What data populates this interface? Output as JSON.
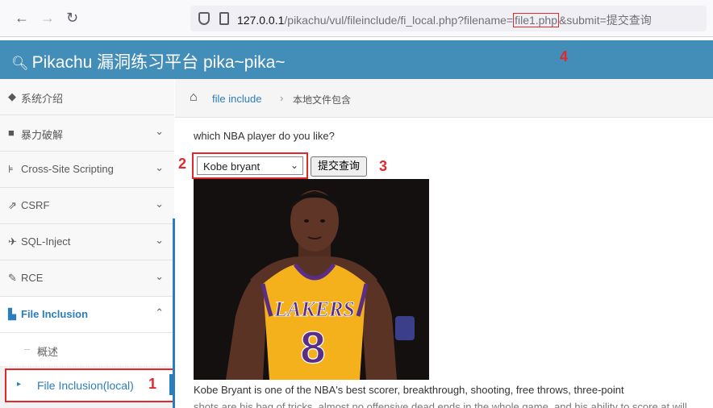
{
  "browser": {
    "url_prefix": "127.0.0.1",
    "url_path": "/pikachu/vul/fileinclude/fi_local.php?filename=",
    "url_filename": "file1.php",
    "url_suffix": "&submit=提交查询"
  },
  "header": {
    "brand": "Pikachu 漏洞练习平台 pika~pika~"
  },
  "sidebar": {
    "items": [
      {
        "label": "系统介绍",
        "icon": "tag-icon"
      },
      {
        "label": "暴力破解",
        "icon": "lock-icon"
      },
      {
        "label": "Cross-Site Scripting",
        "icon": "sitemap-icon"
      },
      {
        "label": "CSRF",
        "icon": "share-icon"
      },
      {
        "label": "SQL-Inject",
        "icon": "plane-icon"
      },
      {
        "label": "RCE",
        "icon": "pencil-icon"
      },
      {
        "label": "File Inclusion",
        "icon": "file-icon"
      }
    ],
    "sub_items": [
      {
        "label": "概述"
      },
      {
        "label": "File Inclusion(local)"
      }
    ]
  },
  "breadcrumb": {
    "link": "file include",
    "current": "本地文件包含"
  },
  "main": {
    "question": "which NBA player do you like?",
    "select_value": "Kobe bryant",
    "submit_label": "提交查询",
    "description": "Kobe Bryant is one of the NBA's best scorer, breakthrough, shooting, free throws, three-point",
    "description_cont": "shots are his bag of tricks, almost no offensive dead ends in the whole game, and his ability to score at will"
  },
  "jersey": {
    "team": "LAKERS",
    "number": "8"
  },
  "annotations": [
    "1",
    "2",
    "3",
    "4"
  ],
  "colors": {
    "header_blue": "#438eb9",
    "link_blue": "#2b7dbc",
    "annotation_red": "#e0282e"
  }
}
